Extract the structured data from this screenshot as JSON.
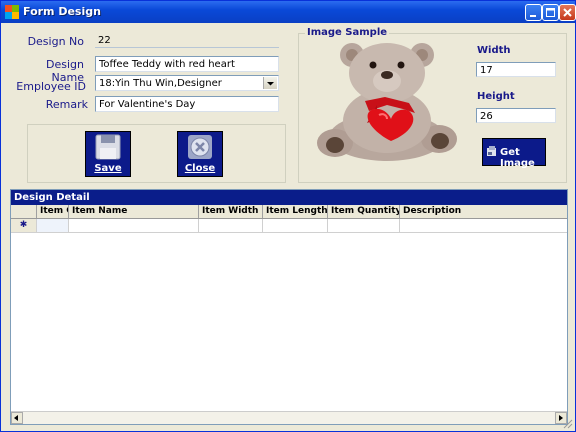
{
  "window": {
    "title": "Form Design"
  },
  "fields": {
    "design_no": {
      "label": "Design No",
      "value": "22"
    },
    "design_name": {
      "label": "Design Name",
      "value": "Toffee Teddy with red heart"
    },
    "employee_id": {
      "label": "Employee ID",
      "value": "18:Yin Thu Win,Designer"
    },
    "remark": {
      "label": "Remark",
      "value": "For Valentine's Day"
    }
  },
  "buttons": {
    "save": {
      "label": "Save",
      "icon": "floppy-disk-icon"
    },
    "close": {
      "label": "Close",
      "icon": "close-circle-icon"
    },
    "get_image": {
      "label": "Get Image",
      "icon": "image-icon"
    }
  },
  "image_sample": {
    "title": "Image Sample",
    "width": {
      "label": "Width",
      "value": "17"
    },
    "height": {
      "label": "Height",
      "value": "26"
    }
  },
  "grid": {
    "caption": "Design Detail",
    "columns": [
      "Item C",
      "Item Name",
      "Item Width",
      "Item Length",
      "Item Quantity",
      "Description"
    ],
    "new_row_marker": "✱"
  },
  "colors": {
    "accent": "#0c1a8a",
    "label": "#1a1a8a",
    "title_bar": "#0a49d8"
  }
}
